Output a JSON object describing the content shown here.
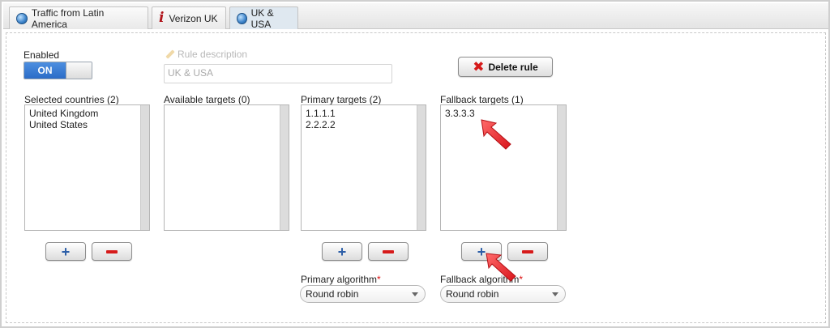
{
  "tabs": [
    {
      "label": "Traffic from Latin America",
      "icon": "globe-icon"
    },
    {
      "label": "Verizon UK",
      "icon": "info-icon"
    },
    {
      "label": "UK & USA",
      "icon": "globe-icon"
    }
  ],
  "enabled": {
    "label": "Enabled",
    "toggle_label": "ON"
  },
  "description": {
    "label": "Rule description",
    "value": "UK & USA"
  },
  "delete_button": {
    "label": "Delete rule"
  },
  "selected_countries": {
    "label": "Selected countries (2)",
    "items": [
      "United Kingdom",
      "United States"
    ]
  },
  "available_targets": {
    "label": "Available targets (0)",
    "items": []
  },
  "primary_targets": {
    "label": "Primary targets (2)",
    "items": [
      "1.1.1.1",
      "2.2.2.2"
    ]
  },
  "fallback_targets": {
    "label": "Fallback targets (1)",
    "items": [
      "3.3.3.3"
    ]
  },
  "primary_algorithm": {
    "label": "Primary algorithm",
    "required_mark": "*",
    "value": "Round robin"
  },
  "fallback_algorithm": {
    "label": "Fallback algorithm",
    "required_mark": "*",
    "value": "Round robin"
  },
  "colors": {
    "accent": "#2b6cc7",
    "danger": "#d61a1a",
    "annotation_arrow": "#e8282e"
  }
}
